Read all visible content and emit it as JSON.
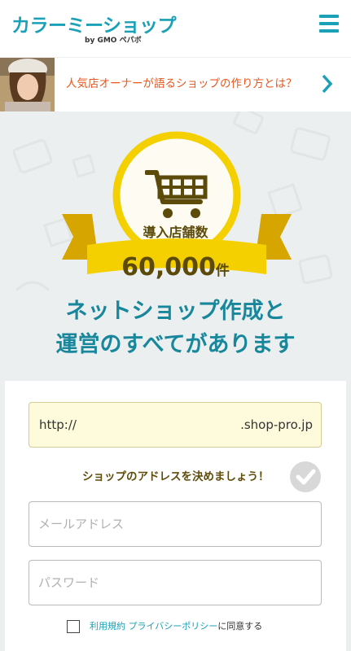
{
  "header": {
    "logo": "カラーミーショップ",
    "logo_by": "by GMO ペパボ",
    "menu_icon": "hamburger-menu-icon"
  },
  "banner": {
    "text": "人気店オーナーが語るショップの作り方とは？",
    "arrow_icon": "chevron-right-icon"
  },
  "hero": {
    "badge_label": "導入店舗数",
    "count": "60,000",
    "count_unit": "件",
    "tagline_line1": "ネットショップ作成と",
    "tagline_line2": "運営のすべてがあります"
  },
  "form": {
    "url_prefix": "http://",
    "url_value": "",
    "url_suffix": ".shop-pro.jp",
    "address_note": "ショップのアドレスを決めましょう！",
    "email_placeholder": "メールアドレス",
    "password_placeholder": "パスワード",
    "terms_link": "利用規約",
    "privacy_link": "プライバシーポリシー",
    "terms_suffix": "に同意する"
  },
  "colors": {
    "brand": "#1aa1b8",
    "accent_orange": "#e8571e",
    "gold": "#f4d000",
    "url_box": "#fefbdc"
  }
}
